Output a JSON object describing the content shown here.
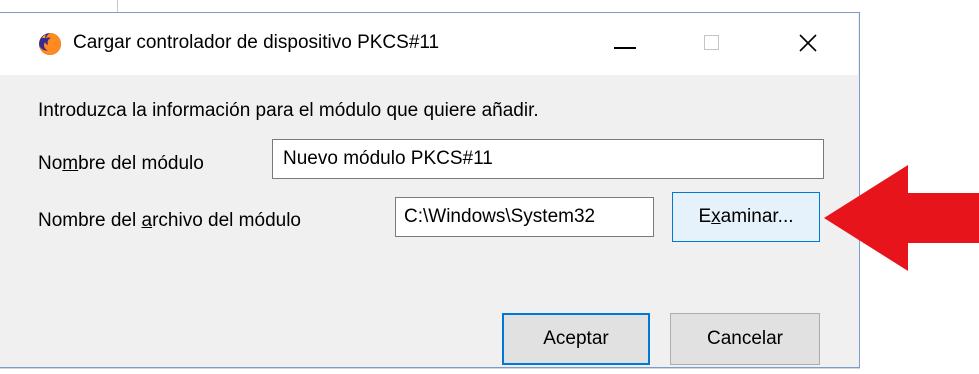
{
  "window": {
    "title": "Cargar controlador de dispositivo PKCS#11",
    "app_icon": "firefox-icon",
    "controls": {
      "minimize_icon": "minimize-icon",
      "maximize_icon": "maximize-icon",
      "close_icon": "close-icon"
    }
  },
  "form": {
    "intro": "Introduzca la información para el módulo que quiere añadir.",
    "module_name": {
      "label_pre": "No",
      "label_accel": "m",
      "label_post": "bre del módulo",
      "value": "Nuevo módulo PKCS#11"
    },
    "module_file": {
      "label_pre": "Nombre del ",
      "label_accel": "a",
      "label_post": "rchivo del módulo",
      "value": "C:\\Windows\\System32"
    },
    "browse_button": {
      "label_pre": "E",
      "label_accel": "x",
      "label_post": "aminar..."
    }
  },
  "footer": {
    "accept_label": "Aceptar",
    "cancel_label": "Cancelar"
  },
  "annotation": {
    "arrow_color": "#e8141c",
    "arrow_icon": "left-arrow-icon"
  },
  "colors": {
    "accent_border": "#0078d7",
    "browse_bg": "#e5f1fb",
    "dialog_bg": "#f0f0f0"
  }
}
